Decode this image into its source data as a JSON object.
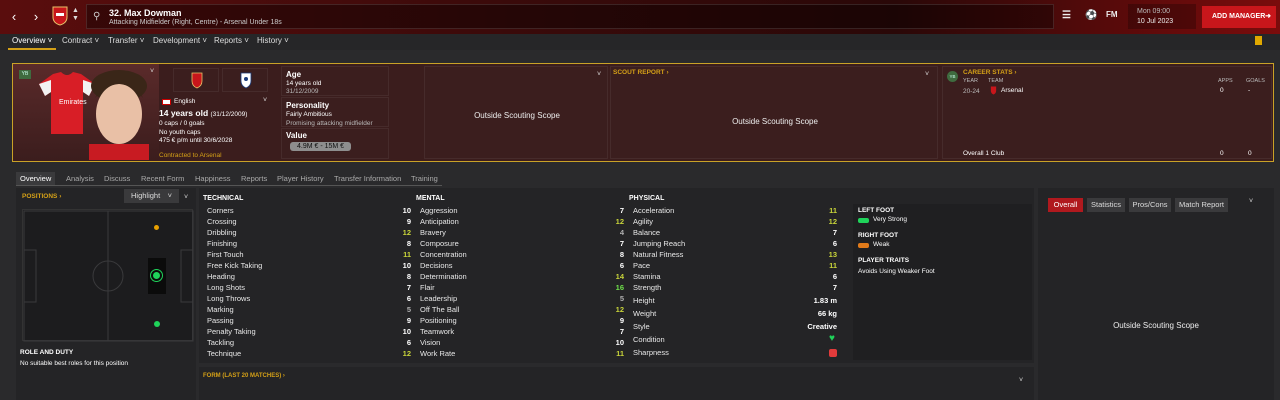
{
  "topbar": {
    "back_icon": "chevron-left-icon",
    "forward_icon": "chevron-right-icon",
    "player_title": "32. Max Dowman",
    "player_subtitle": "Attacking Midfielder (Right, Centre) - Arsenal Under 18s",
    "fm_label": "FM",
    "time": "Mon 09:00",
    "date": "10 Jul 2023",
    "add_manager": "ADD MANAGER"
  },
  "main_tabs": [
    "Overview",
    "Contract",
    "Transfer",
    "Development",
    "Reports",
    "History"
  ],
  "header": {
    "badge": "YB",
    "nationality": "English",
    "age_line": "14 years old",
    "dob_paren": "(31/12/2009)",
    "caps": "0 caps / 0 goals",
    "youth_caps": "No youth caps",
    "wage": "475 € p/m until 30/6/2028",
    "contracted": "Contracted to Arsenal",
    "age_label": "Age",
    "age_value": "14 years old",
    "age_dob": "31/12/2009",
    "personality_label": "Personality",
    "personality_value": "Fairly Ambitious",
    "personality_sub": "Promising attacking midfielder",
    "value_label": "Value",
    "value_range": "4.9M € - 15M €",
    "outside_scope_1": "Outside Scouting Scope",
    "scout_report": "SCOUT REPORT",
    "outside_scope_2": "Outside Scouting Scope",
    "career_stats": "CAREER STATS",
    "career_badge": "YB",
    "col_year": "YEAR",
    "col_team": "TEAM",
    "col_apps": "APPS",
    "col_goals": "GOALS",
    "row_year": "20-24",
    "row_team": "Arsenal",
    "row_apps": "0",
    "row_goals": "-",
    "total_label": "Overall 1 Club",
    "total_apps": "0",
    "total_goals": "0"
  },
  "sub_tabs": [
    "Overview",
    "Analysis",
    "Discuss",
    "Recent Form",
    "Happiness",
    "Reports",
    "Player History",
    "Transfer Information",
    "Training"
  ],
  "positions": {
    "title": "POSITIONS",
    "highlight": "Highlight",
    "role_title": "ROLE AND DUTY",
    "role_text": "No suitable best roles for this position"
  },
  "attributes": {
    "technical_title": "TECHNICAL",
    "mental_title": "MENTAL",
    "physical_title": "PHYSICAL",
    "technical": [
      {
        "name": "Corners",
        "value": "10"
      },
      {
        "name": "Crossing",
        "value": "9"
      },
      {
        "name": "Dribbling",
        "value": "12"
      },
      {
        "name": "Finishing",
        "value": "8"
      },
      {
        "name": "First Touch",
        "value": "11"
      },
      {
        "name": "Free Kick Taking",
        "value": "10"
      },
      {
        "name": "Heading",
        "value": "8"
      },
      {
        "name": "Long Shots",
        "value": "7"
      },
      {
        "name": "Long Throws",
        "value": "6"
      },
      {
        "name": "Marking",
        "value": "5"
      },
      {
        "name": "Passing",
        "value": "9"
      },
      {
        "name": "Penalty Taking",
        "value": "10"
      },
      {
        "name": "Tackling",
        "value": "6"
      },
      {
        "name": "Technique",
        "value": "12"
      }
    ],
    "mental": [
      {
        "name": "Aggression",
        "value": "7"
      },
      {
        "name": "Anticipation",
        "value": "12"
      },
      {
        "name": "Bravery",
        "value": "4"
      },
      {
        "name": "Composure",
        "value": "7"
      },
      {
        "name": "Concentration",
        "value": "8"
      },
      {
        "name": "Decisions",
        "value": "6"
      },
      {
        "name": "Determination",
        "value": "14"
      },
      {
        "name": "Flair",
        "value": "16"
      },
      {
        "name": "Leadership",
        "value": "5"
      },
      {
        "name": "Off The Ball",
        "value": "12"
      },
      {
        "name": "Positioning",
        "value": "9"
      },
      {
        "name": "Teamwork",
        "value": "7"
      },
      {
        "name": "Vision",
        "value": "10"
      },
      {
        "name": "Work Rate",
        "value": "11"
      }
    ],
    "physical": [
      {
        "name": "Acceleration",
        "value": "11"
      },
      {
        "name": "Agility",
        "value": "12"
      },
      {
        "name": "Balance",
        "value": "7"
      },
      {
        "name": "Jumping Reach",
        "value": "6"
      },
      {
        "name": "Natural Fitness",
        "value": "13"
      },
      {
        "name": "Pace",
        "value": "11"
      },
      {
        "name": "Stamina",
        "value": "6"
      },
      {
        "name": "Strength",
        "value": "7"
      }
    ],
    "physical_extra": [
      {
        "name": "Height",
        "value": "1.83 m"
      },
      {
        "name": "Weight",
        "value": "66 kg"
      },
      {
        "name": "Style",
        "value": "Creative"
      },
      {
        "name": "Condition",
        "value": ""
      },
      {
        "name": "Sharpness",
        "value": ""
      }
    ]
  },
  "feet": {
    "left_title": "LEFT FOOT",
    "left_value": "Very Strong",
    "right_title": "RIGHT FOOT",
    "right_value": "Weak",
    "traits_title": "PLAYER TRAITS",
    "trait": "Avoids Using Weaker Foot"
  },
  "right_panel": {
    "tabs": [
      "Overall",
      "Statistics",
      "Pros/Cons",
      "Match Report"
    ],
    "outside_scope": "Outside Scouting Scope"
  },
  "form": {
    "title": "FORM (LAST 20 MATCHES)"
  },
  "colors": {
    "accent_gold": "#d4a017",
    "good_green": "#7fd13b",
    "high_green": "#a6d13b",
    "brand_red": "#c8161b"
  }
}
